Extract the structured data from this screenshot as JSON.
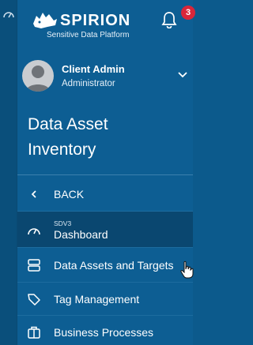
{
  "brand": {
    "name": "SPIRION",
    "tagline": "Sensitive Data Platform"
  },
  "notifications": {
    "count": "3"
  },
  "user": {
    "name": "Client Admin",
    "role": "Administrator"
  },
  "page": {
    "title_line1": "Data Asset",
    "title_line2": "Inventory"
  },
  "nav": {
    "back": {
      "label": "BACK",
      "icon": "chevron-left-icon"
    },
    "items": [
      {
        "label": "Dashboard",
        "sublabel": "SDV3",
        "icon": "speedometer-icon",
        "active": true
      },
      {
        "label": "Data Assets and Targets",
        "icon": "server-icon",
        "active": false
      },
      {
        "label": "Tag Management",
        "icon": "tag-icon",
        "active": false
      },
      {
        "label": "Business Processes",
        "icon": "briefcase-icon",
        "active": false
      }
    ]
  },
  "colors": {
    "sidebar": "#0d5e93",
    "rail": "#0a4f7b",
    "active_item": "#0a4770",
    "badge": "#d8263a"
  }
}
